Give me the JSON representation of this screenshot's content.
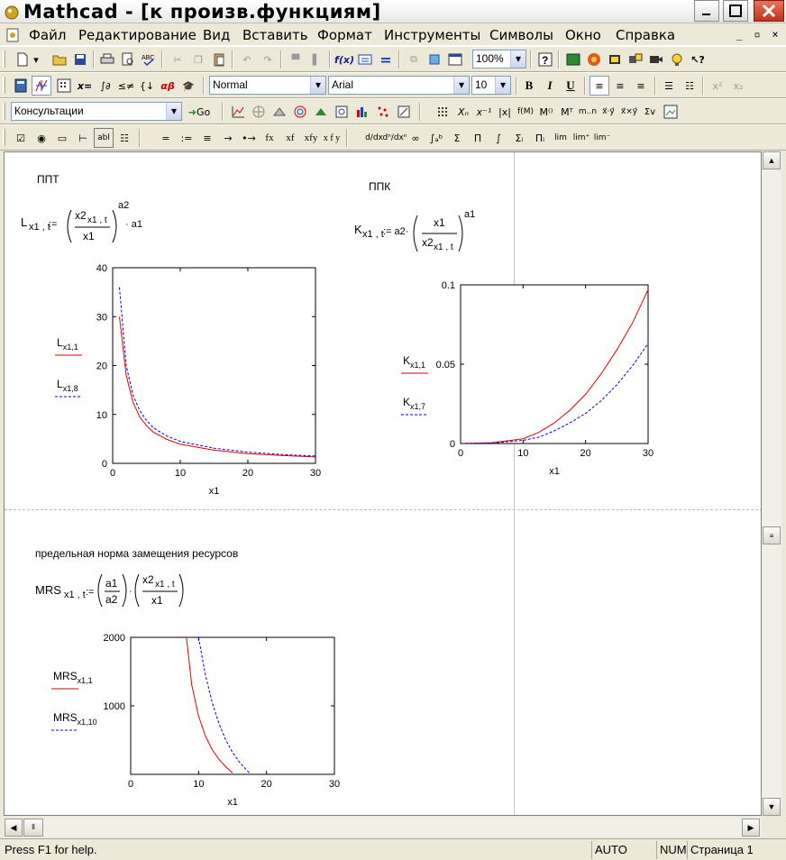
{
  "window": {
    "title": "Mathcad - [к произв.функциям]"
  },
  "menu": [
    {
      "label": "Файл"
    },
    {
      "label": "Редактирование"
    },
    {
      "label": "Вид"
    },
    {
      "label": "Вставить"
    },
    {
      "label": "Формат"
    },
    {
      "label": "Инструменты"
    },
    {
      "label": "Символы"
    },
    {
      "label": "Окно"
    },
    {
      "label": "Справка"
    }
  ],
  "toolbar": {
    "zoom": "100%",
    "style": "Normal",
    "font": "Arial",
    "font_size": "10",
    "resource": "Консультации",
    "go_label": "Go",
    "bold": "B",
    "italic": "I",
    "underline": "U",
    "calc_labels": [
      "=",
      ":=",
      "≡",
      "→",
      "•→",
      "fx",
      "xf",
      "xfy",
      "x f y"
    ],
    "math_symbols": [
      "f(x)",
      "m..n",
      "x⁻¹",
      "|x|",
      "Σ",
      "Π",
      "lim",
      "∞",
      "∫"
    ]
  },
  "document": {
    "ppt_label": "ППТ",
    "ppk_label": "ППК",
    "mrs_caption": "предельная норма замещения ресурсов",
    "formula_L": {
      "lhs": "L",
      "sub": "x1 , t",
      "assign": ":=",
      "num": "x2",
      "num_sub": "x1 , t",
      "den": "x1",
      "exp": "a2",
      "tail": "· a1"
    },
    "formula_K": {
      "lhs": "K",
      "sub": "x1 , t",
      "assign": ":= a2·",
      "num": "x1",
      "den": "x2",
      "den_sub": "x1 , t",
      "exp": "a1"
    },
    "formula_MRS": {
      "lhs": "MRS",
      "sub": "x1 , t",
      "assign": ":=",
      "a_num": "a1",
      "a_den": "a2",
      "num": "x2",
      "num_sub": "x1 , t",
      "den": "x1"
    }
  },
  "chart_data": [
    {
      "type": "line",
      "xlabel": "x1",
      "xlim": [
        0,
        30
      ],
      "ylim": [
        0,
        40
      ],
      "xticks": [
        0,
        10,
        20,
        30
      ],
      "yticks": [
        0,
        10,
        20,
        30,
        40
      ],
      "legend_placement": "left",
      "series": [
        {
          "name": "L x1,1",
          "color": "#e00000",
          "dash": "solid",
          "x": [
            1,
            2,
            3,
            4,
            5,
            6,
            8,
            10,
            15,
            20,
            25,
            30
          ],
          "y": [
            30,
            18,
            12.5,
            9.5,
            7.7,
            6.4,
            4.9,
            3.9,
            2.7,
            2.0,
            1.6,
            1.3
          ]
        },
        {
          "name": "L x1,8",
          "color": "#0000d0",
          "dash": "dashed",
          "x": [
            1,
            2,
            3,
            4,
            5,
            6,
            8,
            10,
            15,
            20,
            25,
            30
          ],
          "y": [
            36,
            20,
            14,
            10.8,
            8.8,
            7.3,
            5.6,
            4.5,
            3.1,
            2.3,
            1.8,
            1.5
          ]
        }
      ]
    },
    {
      "type": "line",
      "xlabel": "x1",
      "xlim": [
        0,
        30
      ],
      "ylim": [
        0,
        0.1
      ],
      "xticks": [
        0,
        10,
        20,
        30
      ],
      "yticks": [
        0,
        0.05,
        0.1
      ],
      "legend_placement": "left",
      "series": [
        {
          "name": "K x1,1",
          "color": "#e00000",
          "dash": "solid",
          "x": [
            0,
            5,
            10,
            12.5,
            15,
            17.5,
            20,
            22.5,
            25,
            27.5,
            30
          ],
          "y": [
            0,
            0.0005,
            0.003,
            0.007,
            0.013,
            0.021,
            0.031,
            0.044,
            0.059,
            0.076,
            0.097
          ]
        },
        {
          "name": "K x1,7",
          "color": "#0000d0",
          "dash": "dashed",
          "x": [
            0,
            5,
            10,
            12.5,
            15,
            17.5,
            20,
            22.5,
            25,
            27.5,
            30
          ],
          "y": [
            0,
            0.0003,
            0.002,
            0.004,
            0.008,
            0.013,
            0.019,
            0.027,
            0.037,
            0.049,
            0.063
          ]
        }
      ]
    },
    {
      "type": "line",
      "xlabel": "x1",
      "xlim": [
        0,
        30
      ],
      "ylim": [
        0,
        2000
      ],
      "xticks": [
        0,
        10,
        20,
        30
      ],
      "yticks": [
        1000,
        2000
      ],
      "legend_placement": "left",
      "series": [
        {
          "name": "MRS x1,1",
          "color": "#e00000",
          "dash": "solid",
          "x": [
            8.2,
            9,
            10,
            11,
            12,
            13,
            14,
            15
          ],
          "y": [
            2000,
            1300,
            850,
            560,
            360,
            220,
            110,
            20
          ]
        },
        {
          "name": "MRS x1,10",
          "color": "#0000d0",
          "dash": "dashed",
          "x": [
            10,
            11,
            12,
            13,
            14,
            15,
            16,
            17,
            17.6
          ],
          "y": [
            2000,
            1450,
            1050,
            740,
            500,
            320,
            180,
            70,
            10
          ]
        }
      ]
    }
  ],
  "status": {
    "help": "Press F1 for help.",
    "mode": "AUTO",
    "num": "NUM",
    "page": "Страница 1"
  }
}
